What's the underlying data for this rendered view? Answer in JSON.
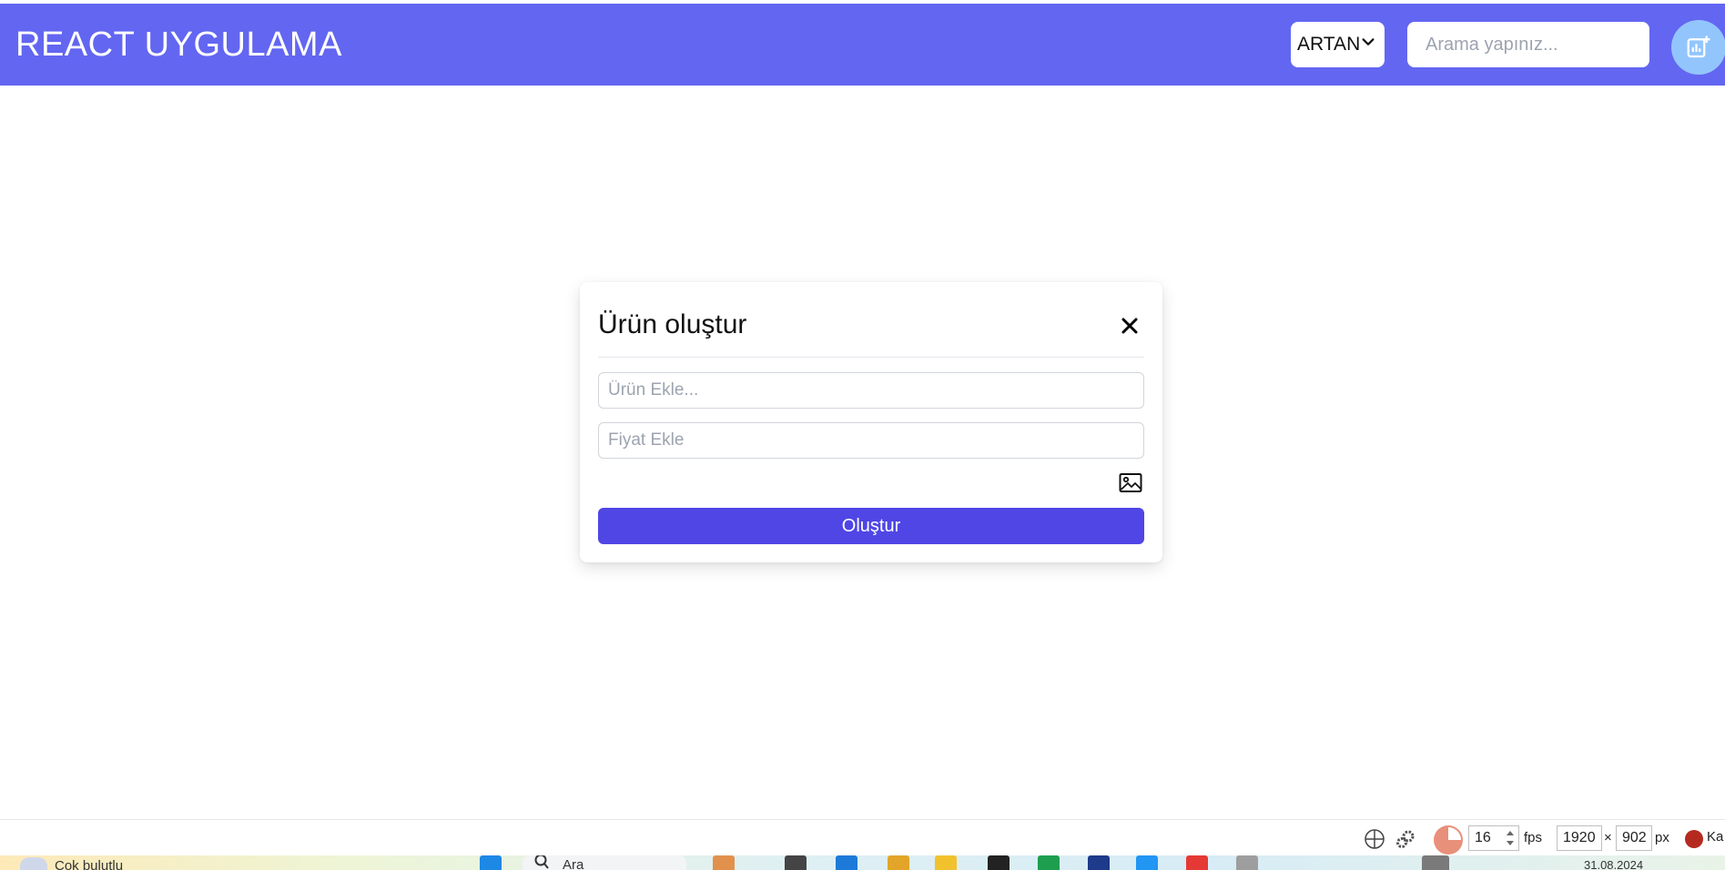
{
  "header": {
    "brand": "REACT UYGULAMA",
    "sort_value": "ARTAN",
    "search_placeholder": "Arama yapınız...",
    "add_button_icon": "add-chart-icon"
  },
  "modal": {
    "title": "Ürün oluştur",
    "close_icon": "close-icon",
    "name_placeholder": "Ürün Ekle...",
    "price_placeholder": "Fiyat Ekle",
    "image_icon": "image-icon",
    "submit_label": "Oluştur"
  },
  "util_bar": {
    "fps_value": "16",
    "fps_label": "fps",
    "width_value": "1920",
    "times": "×",
    "height_value": "902",
    "unit": "px",
    "record_label": "Ka"
  },
  "taskbar": {
    "weather": "Çok bulutlu",
    "search": "Ara",
    "date": "31.08.2024"
  },
  "colors": {
    "header_bg": "#6366f1",
    "primary_button": "#4f46e5",
    "add_button": "#93c5fd"
  }
}
